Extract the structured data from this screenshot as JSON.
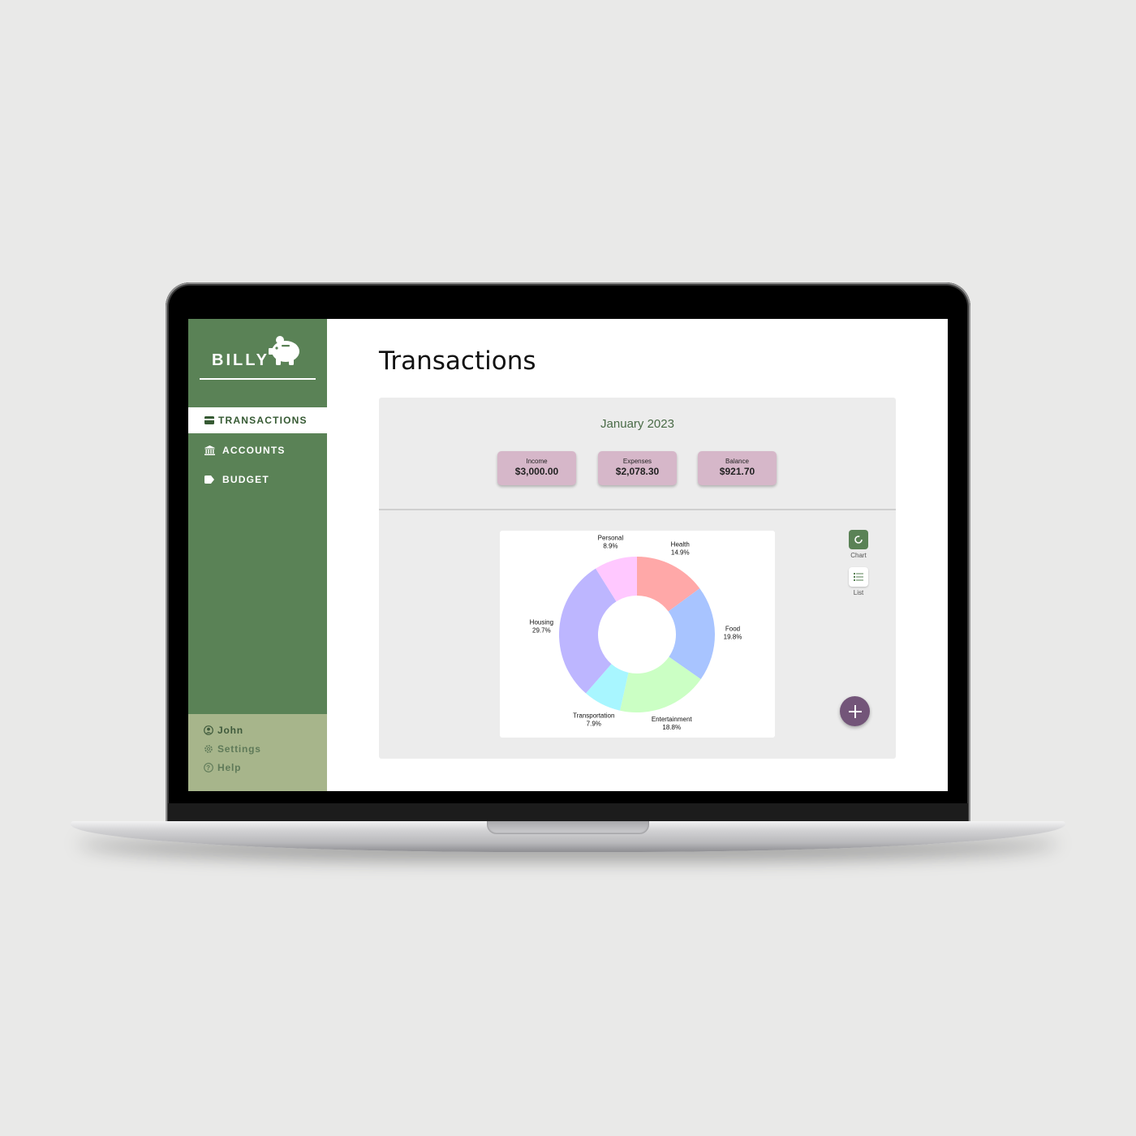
{
  "app": {
    "name": "BILLY"
  },
  "nav": {
    "items": [
      {
        "label": "TRANSACTIONS",
        "icon": "credit-card-icon"
      },
      {
        "label": "ACCOUNTS",
        "icon": "bank-icon"
      },
      {
        "label": "BUDGET",
        "icon": "tag-icon"
      }
    ]
  },
  "user": {
    "name": "John",
    "settings": "Settings",
    "help": "Help"
  },
  "page": {
    "title": "Transactions"
  },
  "summary": {
    "month": "January 2023",
    "income": {
      "label": "Income",
      "value": "$3,000.00"
    },
    "expenses": {
      "label": "Expenses",
      "value": "$2,078.30"
    },
    "balance": {
      "label": "Balance",
      "value": "$921.70"
    }
  },
  "view_toggle": {
    "chart": "Chart",
    "list": "List"
  },
  "colors": {
    "sidebar": "#5a8256",
    "sidebar_bottom": "#a7b58b",
    "stat_card": "#d6b7c9",
    "fab": "#735579"
  },
  "chart_data": {
    "type": "pie",
    "categories": [
      "Health",
      "Food",
      "Entertainment",
      "Transportation",
      "Housing",
      "Personal"
    ],
    "values": [
      14.9,
      19.8,
      18.8,
      7.9,
      29.7,
      8.9
    ],
    "labels": [
      "14.9%",
      "19.8%",
      "18.8%",
      "7.9%",
      "29.7%",
      "8.9%"
    ],
    "colors": [
      "#ffa8a8",
      "#a8c4ff",
      "#cbffc4",
      "#a8f6ff",
      "#bdb6ff",
      "#ffc8ff"
    ],
    "donut": true
  }
}
